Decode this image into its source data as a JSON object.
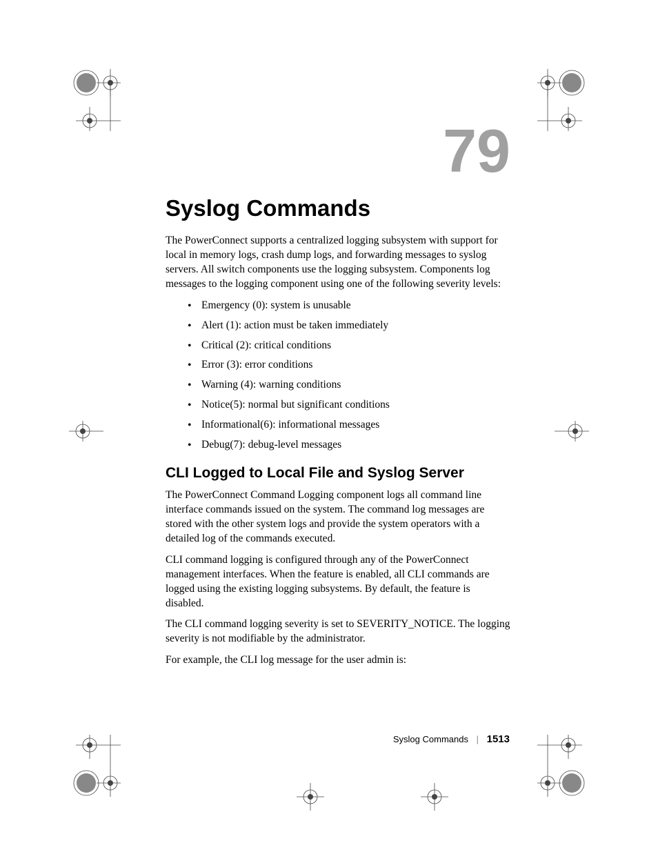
{
  "chapter": {
    "number": "79",
    "title": "Syslog Commands"
  },
  "intro_paragraph": "The PowerConnect supports a centralized logging subsystem with support for local in memory logs, crash dump logs, and forwarding messages to syslog servers. All switch components use the logging subsystem. Components log messages to the logging component using one of the following severity levels:",
  "severity_levels": [
    "Emergency (0): system is unusable",
    "Alert (1): action must be taken immediately",
    "Critical (2): critical conditions",
    "Error (3): error conditions",
    "Warning (4): warning conditions",
    "Notice(5): normal but significant conditions",
    "Informational(6): informational messages",
    "Debug(7): debug-level messages"
  ],
  "section": {
    "heading": "CLI Logged to Local File and Syslog Server",
    "paragraphs": [
      "The PowerConnect Command Logging component logs all command line interface commands issued on the system. The command log messages are stored with the other system logs and provide the system operators with a detailed log of the commands executed.",
      "CLI command logging is configured through any of the PowerConnect management interfaces. When the feature is enabled, all CLI commands are logged using the existing logging subsystems. By default, the feature is disabled.",
      "The CLI command logging severity is set to SEVERITY_NOTICE. The logging severity is not modifiable by the administrator.",
      "For example, the CLI log message for the user admin is:"
    ]
  },
  "footer": {
    "title": "Syslog Commands",
    "separator": "|",
    "page_number": "1513"
  }
}
